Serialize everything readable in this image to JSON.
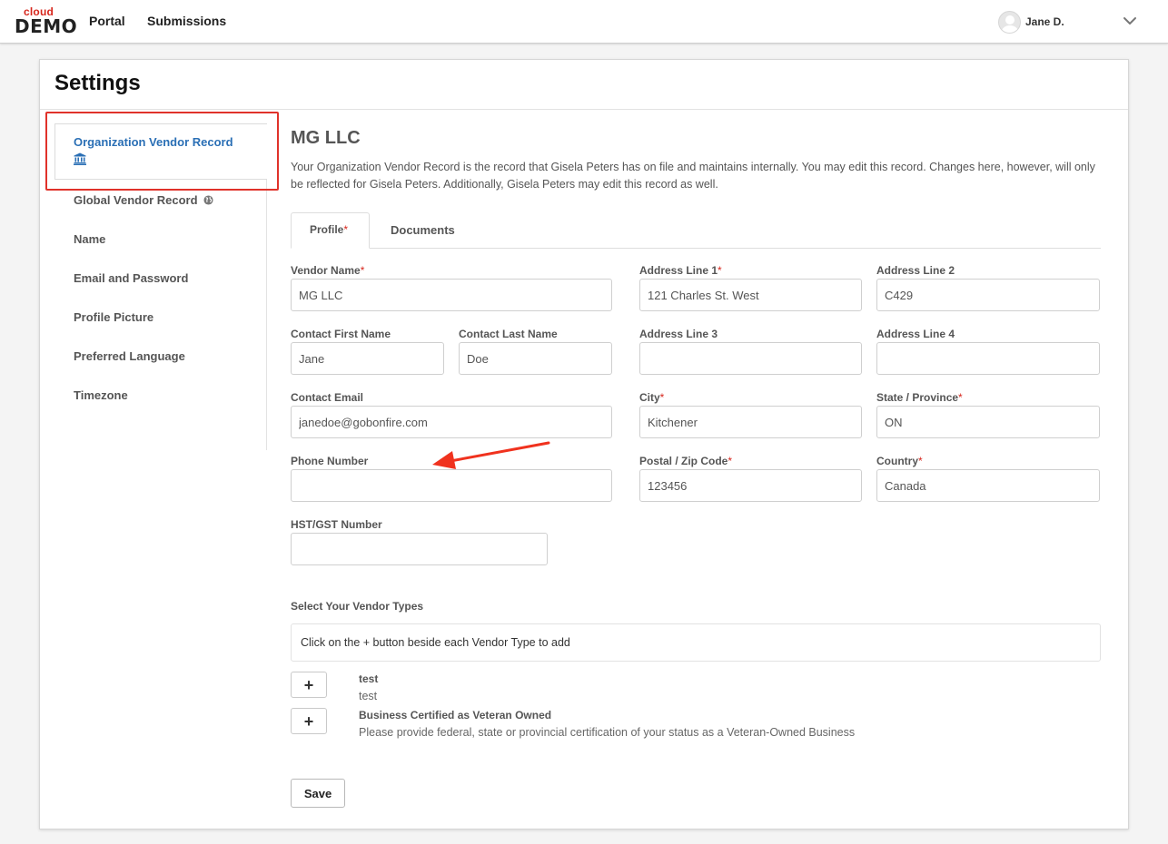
{
  "nav": {
    "logo_top": "cloud",
    "logo_bottom": "DEMO",
    "links": [
      "Portal",
      "Submissions"
    ],
    "user_name": "Jane D."
  },
  "page": {
    "title": "Settings"
  },
  "sidebar": {
    "active_item": "Organization Vendor Record",
    "items": [
      "Global Vendor Record",
      "Name",
      "Email and Password",
      "Profile Picture",
      "Preferred Language",
      "Timezone"
    ]
  },
  "record": {
    "title": "MG LLC",
    "description": "Your Organization Vendor Record is the record that Gisela Peters has on file and maintains internally. You may edit this record. Changes here, however, will only be reflected for Gisela Peters. Additionally, Gisela Peters may edit this record as well."
  },
  "tabs": {
    "profile": "Profile",
    "required_mark": "*",
    "documents": "Documents"
  },
  "form": {
    "vendor_name": {
      "label": "Vendor Name",
      "value": "MG LLC"
    },
    "contact_first_name": {
      "label": "Contact First Name",
      "value": "Jane"
    },
    "contact_last_name": {
      "label": "Contact Last Name",
      "value": "Doe"
    },
    "contact_email": {
      "label": "Contact Email",
      "value": "janedoe@gobonfire.com"
    },
    "phone_number": {
      "label": "Phone Number",
      "value": ""
    },
    "hst_gst_number": {
      "label": "HST/GST Number",
      "value": ""
    },
    "address_line_1": {
      "label": "Address Line 1",
      "value": "121 Charles St. West"
    },
    "address_line_2": {
      "label": "Address Line 2",
      "value": "C429"
    },
    "address_line_3": {
      "label": "Address Line 3",
      "value": ""
    },
    "address_line_4": {
      "label": "Address Line 4",
      "value": ""
    },
    "city": {
      "label": "City",
      "value": "Kitchener"
    },
    "state_province": {
      "label": "State / Province",
      "value": "ON"
    },
    "postal_zip": {
      "label": "Postal / Zip Code",
      "value": "123456"
    },
    "country": {
      "label": "Country",
      "value": "Canada"
    }
  },
  "vendor_types": {
    "label": "Select Your Vendor Types",
    "hint": "Click on the + button beside each Vendor Type to add",
    "add_symbol": "+",
    "items": [
      {
        "name": "test",
        "description": "test"
      },
      {
        "name": "Business Certified as Veteran Owned",
        "description": "Please provide federal, state or provincial certification of your status as a Veteran-Owned Business"
      }
    ]
  },
  "actions": {
    "save_label": "Save"
  },
  "colors": {
    "link_blue": "#2a6fb5",
    "required_red": "#d7261c",
    "annotation_red": "#e0322a"
  },
  "icons": {
    "active_item_icon": "bank-icon",
    "global_item_icon": "globe-icon",
    "user_menu_icon": "chevron-down-icon"
  }
}
